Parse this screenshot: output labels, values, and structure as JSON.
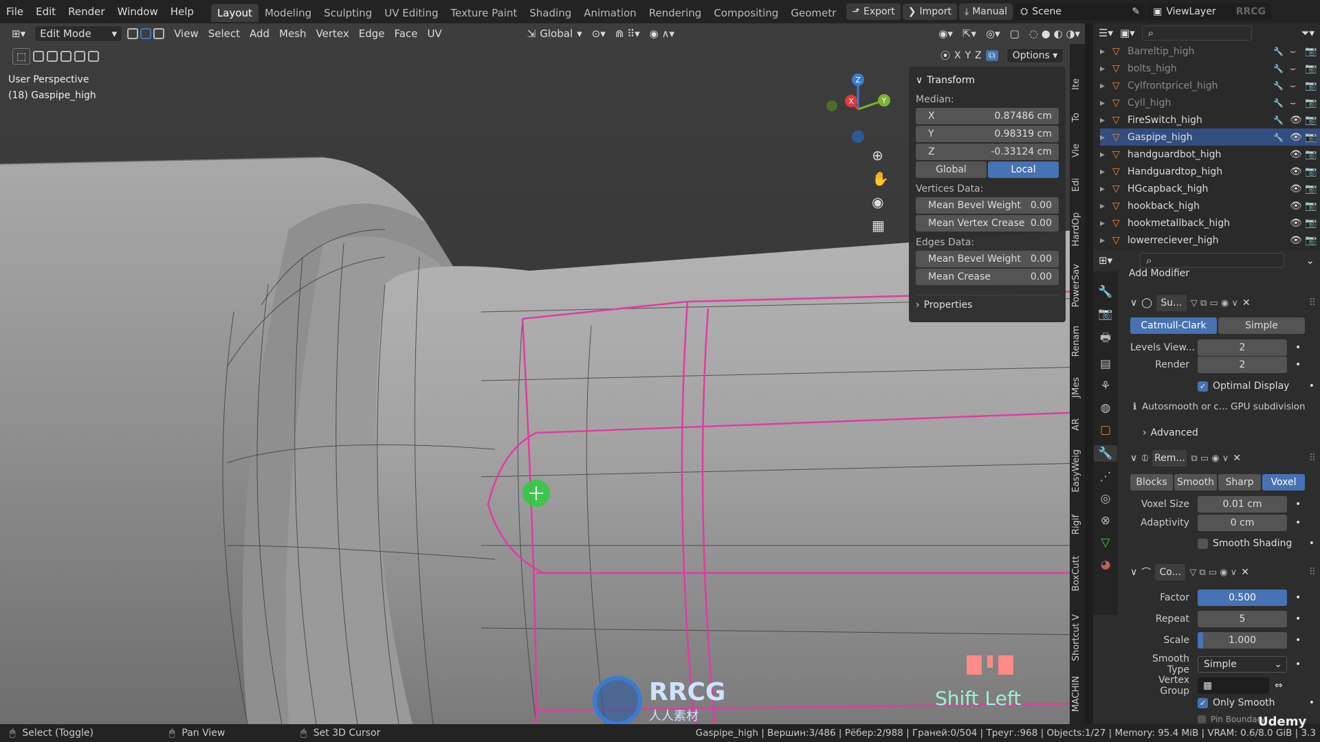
{
  "topbar": {
    "menus": [
      "File",
      "Edit",
      "Render",
      "Window",
      "Help"
    ],
    "workspaces": [
      "Layout",
      "Modeling",
      "Sculpting",
      "UV Editing",
      "Texture Paint",
      "Shading",
      "Animation",
      "Rendering",
      "Compositing",
      "Geometr"
    ],
    "active_workspace": "Layout",
    "export_label": "Export",
    "import_label": "Import",
    "manual_label": "Manual",
    "scene_label": "Scene",
    "viewlayer_label": "ViewLayer",
    "watermark_corner": "RRCG"
  },
  "viewport_header": {
    "mode": "Edit Mode",
    "menus": [
      "View",
      "Select",
      "Add",
      "Mesh",
      "Vertex",
      "Edge",
      "Face",
      "UV"
    ],
    "transform_orientation": "Global",
    "axes": [
      "X",
      "Y",
      "Z"
    ],
    "options_label": "Options"
  },
  "viewport": {
    "perspective_label": "User Perspective",
    "object_label": "(18) Gaspipe_high",
    "key_hint": "Shift Left",
    "watermark_logo_text": "RRCG",
    "watermark_logo_sub": "人人素材",
    "gizmo_axes": [
      "X",
      "Y",
      "Z"
    ]
  },
  "npanel": {
    "transform_title": "Transform",
    "median_label": "Median:",
    "x_label": "X",
    "x_value": "0.87486 cm",
    "y_label": "Y",
    "y_value": "0.98319 cm",
    "z_label": "Z",
    "z_value": "-0.33124 cm",
    "global_label": "Global",
    "local_label": "Local",
    "vertices_data_label": "Vertices Data:",
    "mean_bevel_weight_label": "Mean Bevel Weight",
    "mean_bevel_weight_value": "0.00",
    "mean_vertex_crease_label": "Mean Vertex Crease",
    "mean_vertex_crease_value": "0.00",
    "edges_data_label": "Edges Data:",
    "edge_bevel_weight_label": "Mean Bevel Weight",
    "edge_bevel_weight_value": "0.00",
    "mean_crease_label": "Mean Crease",
    "mean_crease_value": "0.00",
    "properties_title": "Properties"
  },
  "side_tabs": [
    "Ite",
    "To",
    "Vie",
    "Edi",
    "HardOp",
    "PowerSav",
    "Renam",
    "JMes",
    "AR",
    "EasyWeig",
    "Rigif",
    "BoxCutt",
    "Shortcut V",
    "MACHIN"
  ],
  "outliner": {
    "items": [
      {
        "name": "Barreltip_high",
        "visible": false,
        "selected": false
      },
      {
        "name": "bolts_high",
        "visible": false,
        "selected": false
      },
      {
        "name": "Cylfrontpricel_high",
        "visible": false,
        "selected": false
      },
      {
        "name": "Cyll_high",
        "visible": false,
        "selected": false
      },
      {
        "name": "FireSwitch_high",
        "visible": true,
        "selected": false
      },
      {
        "name": "Gaspipe_high",
        "visible": true,
        "selected": true
      },
      {
        "name": "handguardbot_high",
        "visible": true,
        "selected": false
      },
      {
        "name": "Handguardtop_high",
        "visible": true,
        "selected": false
      },
      {
        "name": "HGcapback_high",
        "visible": true,
        "selected": false
      },
      {
        "name": "hookback_high",
        "visible": true,
        "selected": false
      },
      {
        "name": "hookmetallback_high",
        "visible": true,
        "selected": false
      },
      {
        "name": "lowerreciever_high",
        "visible": true,
        "selected": false
      }
    ]
  },
  "properties": {
    "add_modifier_label": "Add Modifier",
    "subsurf": {
      "name": "Su...",
      "catmull_label": "Catmull-Clark",
      "simple_label": "Simple",
      "levels_label": "Levels View...",
      "levels_value": "2",
      "render_label": "Render",
      "render_value": "2",
      "optimal_display_label": "Optimal Display",
      "info_text": "Autosmooth or c... GPU subdivision",
      "advanced_label": "Advanced"
    },
    "remesh": {
      "name": "Rem...",
      "modes": [
        "Blocks",
        "Smooth",
        "Sharp",
        "Voxel"
      ],
      "active_mode": "Voxel",
      "voxel_size_label": "Voxel Size",
      "voxel_size_value": "0.01 cm",
      "adaptivity_label": "Adaptivity",
      "adaptivity_value": "0 cm",
      "smooth_shading_label": "Smooth Shading"
    },
    "corrective": {
      "name": "Co...",
      "factor_label": "Factor",
      "factor_value": "0.500",
      "repeat_label": "Repeat",
      "repeat_value": "5",
      "scale_label": "Scale",
      "scale_value": "1.000",
      "smooth_type_label": "Smooth Type",
      "smooth_type_value": "Simple",
      "vertex_group_label": "Vertex Group",
      "only_smooth_label": "Only Smooth",
      "pin_boundary_label": "Pin Boundary"
    }
  },
  "statusbar": {
    "select_label": "Select (Toggle)",
    "pan_label": "Pan View",
    "cursor_label": "Set 3D Cursor",
    "stats": "Gaspipe_high | Вершин:3/486 | Рёбер:2/988 | Граней:0/504 | Треуг.:968 | Objects:1/27 | Memory: 95.4 MiB | VRAM: 0.6/8.0 GiB | 3.3",
    "udemy": "Udemy"
  },
  "colors": {
    "accent": "#4772b3",
    "edge_select": "#e23aa3",
    "vertex_active": "#2ecc40",
    "watermark": "#ff8a8a"
  }
}
